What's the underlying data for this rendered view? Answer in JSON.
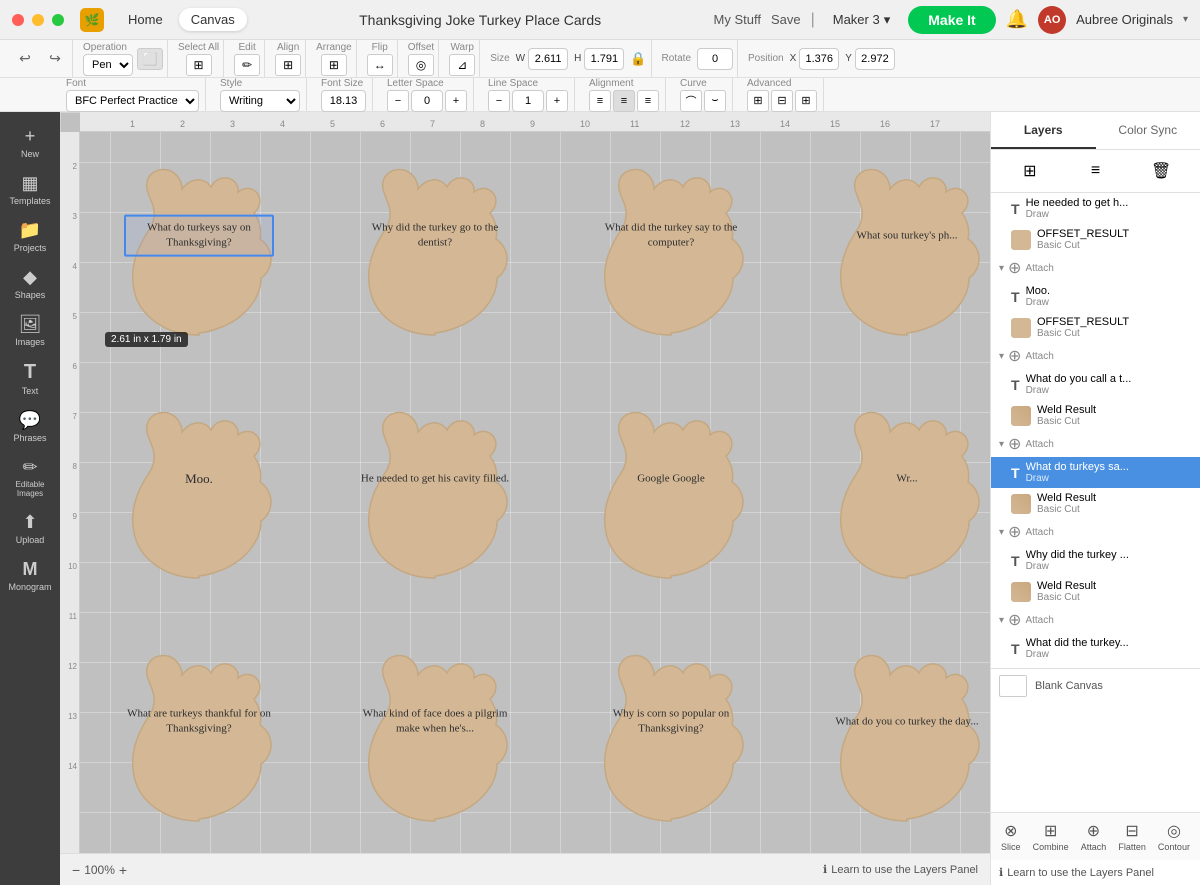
{
  "titlebar": {
    "app_icon": "🟠",
    "nav_home": "Home",
    "nav_canvas": "Canvas",
    "doc_title": "Thanksgiving Joke Turkey Place Cards",
    "btn_my_stuff": "My Stuff",
    "btn_save": "Save",
    "separator": "|",
    "maker_label": "Maker 3",
    "btn_make_it": "Make It",
    "username": "Aubree Originals",
    "chevron": "▾"
  },
  "toolbar": {
    "undo": "↩",
    "redo": "↪",
    "operation_label": "Operation",
    "operation_value": "Pen",
    "select_all_label": "Select All",
    "edit_label": "Edit",
    "align_label": "Align",
    "arrange_label": "Arrange",
    "flip_label": "Flip",
    "offset_label": "Offset",
    "warp_label": "Warp",
    "size_label": "Size",
    "w_label": "W",
    "w_value": "2.611",
    "h_label": "H",
    "h_value": "1.791",
    "lock_icon": "🔒",
    "rotate_label": "Rotate",
    "rotate_value": "0",
    "position_label": "Position",
    "x_label": "X",
    "x_value": "1.376",
    "y_label": "Y",
    "y_value": "2.972"
  },
  "font_toolbar": {
    "font_label": "Font",
    "font_value": "BFC Perfect Practice",
    "style_label": "Style",
    "style_value": "Writing",
    "size_label": "Font Size",
    "size_value": "18.13",
    "letter_space_label": "Letter Space",
    "letter_space_value": "0",
    "line_space_label": "Line Space",
    "line_space_value": "1",
    "alignment_label": "Alignment",
    "curve_label": "Curve",
    "advanced_label": "Advanced"
  },
  "canvas": {
    "zoom": "100%",
    "size_tooltip": "2.61  in x 1.79  in"
  },
  "cards": [
    {
      "id": 1,
      "text": "What do turkeys say on Thanksgiving?",
      "selected": true
    },
    {
      "id": 2,
      "text": "Why did the turkey go to the dentist?"
    },
    {
      "id": 3,
      "text": "What did the turkey say to the computer?"
    },
    {
      "id": 4,
      "text": "What sou turkey's ph..."
    },
    {
      "id": 5,
      "text": "Moo."
    },
    {
      "id": 6,
      "text": "He needed to get his cavity filled."
    },
    {
      "id": 7,
      "text": "Google Google"
    },
    {
      "id": 8,
      "text": "Wr..."
    },
    {
      "id": 9,
      "text": "What are turkeys thankful for on Thanksgiving?"
    },
    {
      "id": 10,
      "text": "What kind of face does a pilgrim make when he's..."
    },
    {
      "id": 11,
      "text": "Why is corn so popular on Thanksgiving?"
    },
    {
      "id": 12,
      "text": "What do you co turkey the day..."
    }
  ],
  "layers_panel": {
    "tab_layers": "Layers",
    "tab_color_sync": "Color Sync",
    "action_grid": "⊞",
    "action_layers": "≡",
    "action_delete": "🗑",
    "items": [
      {
        "type": "text",
        "name": "He needed to get h...",
        "sub": "Draw",
        "selected": false
      },
      {
        "type": "shape",
        "name": "OFFSET_RESULT",
        "sub": "Basic Cut",
        "selected": false
      },
      {
        "type": "attach",
        "label": "Attach"
      },
      {
        "type": "text",
        "name": "Moo.",
        "sub": "Draw",
        "selected": false
      },
      {
        "type": "shape",
        "name": "OFFSET_RESULT",
        "sub": "Basic Cut",
        "selected": false
      },
      {
        "type": "attach",
        "label": "Attach"
      },
      {
        "type": "text",
        "name": "What do you call a t...",
        "sub": "Draw",
        "selected": false
      },
      {
        "type": "shape_weld",
        "name": "Weld Result",
        "sub": "Basic Cut",
        "selected": false
      },
      {
        "type": "attach",
        "label": "Attach"
      },
      {
        "type": "text",
        "name": "What do turkeys sa...",
        "sub": "Draw",
        "selected": true
      },
      {
        "type": "shape_weld",
        "name": "Weld Result",
        "sub": "Basic Cut",
        "selected": false
      },
      {
        "type": "attach",
        "label": "Attach"
      },
      {
        "type": "text",
        "name": "Why did the turkey ...",
        "sub": "Draw",
        "selected": false
      },
      {
        "type": "shape_weld",
        "name": "Weld Result",
        "sub": "Basic Cut",
        "selected": false
      },
      {
        "type": "attach",
        "label": "Attach"
      },
      {
        "type": "text",
        "name": "What did the turkey...",
        "sub": "Draw",
        "selected": false
      }
    ],
    "blank_canvas_label": "Blank Canvas",
    "btn_slice": "Slice",
    "btn_combine": "Combine",
    "btn_attach": "Attach",
    "btn_flatten": "Flatten",
    "btn_contour": "Contour",
    "learn_link": "Learn to use the Layers Panel"
  },
  "sidebar": {
    "items": [
      {
        "id": "new",
        "icon": "+",
        "label": "New"
      },
      {
        "id": "templates",
        "icon": "▦",
        "label": "Templates"
      },
      {
        "id": "projects",
        "icon": "📁",
        "label": "Projects"
      },
      {
        "id": "shapes",
        "icon": "◆",
        "label": "Shapes"
      },
      {
        "id": "images",
        "icon": "🖼",
        "label": "Images"
      },
      {
        "id": "text",
        "icon": "T",
        "label": "Text"
      },
      {
        "id": "phrases",
        "icon": "💬",
        "label": "Phrases"
      },
      {
        "id": "editable-images",
        "icon": "✏",
        "label": "Editable Images"
      },
      {
        "id": "upload",
        "icon": "⬆",
        "label": "Upload"
      },
      {
        "id": "monogram",
        "icon": "M",
        "label": "Monogram"
      }
    ]
  }
}
